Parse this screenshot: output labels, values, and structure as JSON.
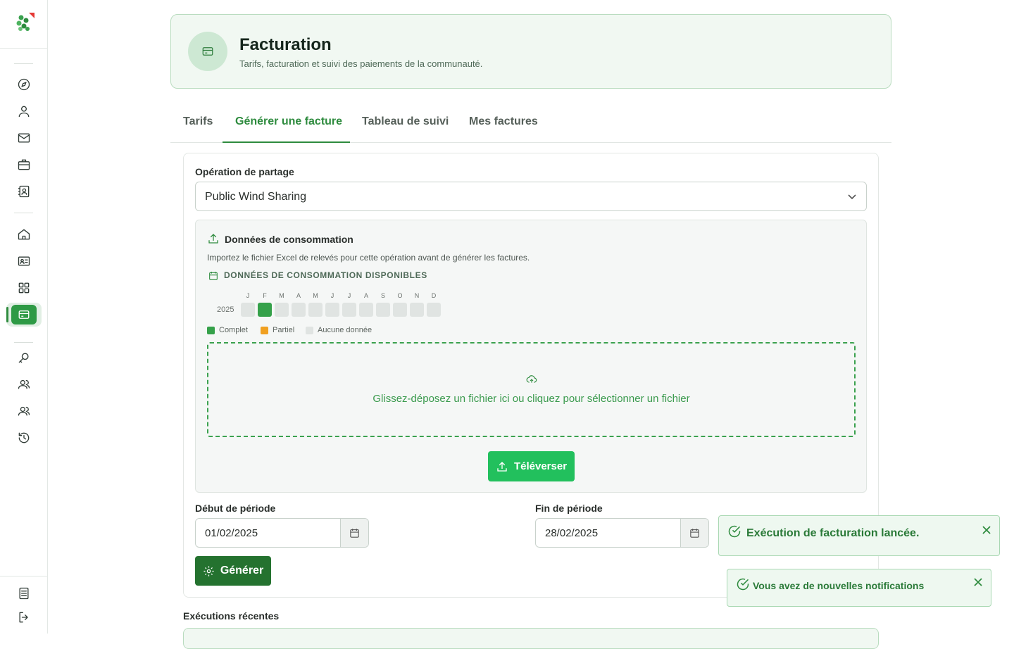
{
  "header": {
    "title": "Facturation",
    "subtitle": "Tarifs, facturation et suivi des paiements de la communauté."
  },
  "tabs": [
    {
      "label": "Tarifs",
      "active": false
    },
    {
      "label": "Générer une facture",
      "active": true
    },
    {
      "label": "Tableau de suivi",
      "active": false
    },
    {
      "label": "Mes factures",
      "active": false
    }
  ],
  "form": {
    "operation_label": "Opération de partage",
    "operation_value": "Public Wind Sharing",
    "consumption": {
      "title": "Données de consommation",
      "description": "Importez le fichier Excel de relevés pour cette opération avant de générer les factures.",
      "available_title": "DONNÉES DE CONSOMMATION DISPONIBLES",
      "year": "2025",
      "months": [
        {
          "letter": "J",
          "status": "none"
        },
        {
          "letter": "F",
          "status": "complete"
        },
        {
          "letter": "M",
          "status": "none"
        },
        {
          "letter": "A",
          "status": "none"
        },
        {
          "letter": "M",
          "status": "none"
        },
        {
          "letter": "J",
          "status": "none"
        },
        {
          "letter": "J",
          "status": "none"
        },
        {
          "letter": "A",
          "status": "none"
        },
        {
          "letter": "S",
          "status": "none"
        },
        {
          "letter": "O",
          "status": "none"
        },
        {
          "letter": "N",
          "status": "none"
        },
        {
          "letter": "D",
          "status": "none"
        }
      ],
      "legend": [
        {
          "label": "Complet",
          "color": "#35a14a"
        },
        {
          "label": "Partiel",
          "color": "#f0a020"
        },
        {
          "label": "Aucune donnée",
          "color": "#e0e4e2"
        }
      ],
      "dropzone_text": "Glissez-déposez un fichier ici ou cliquez pour sélectionner un fichier",
      "upload_label": "Téléverser"
    },
    "period_start_label": "Début de période",
    "period_start_value": "01/02/2025",
    "period_end_label": "Fin de période",
    "period_end_value": "28/02/2025",
    "generate_label": "Générer"
  },
  "recent": {
    "title": "Exécutions récentes"
  },
  "toasts": [
    {
      "text": "Exécution de facturation lancée."
    },
    {
      "text": "Vous avez de nouvelles notifications"
    }
  ],
  "colors": {
    "accent": "#2e8b3e",
    "upload": "#22c05d",
    "generate": "#24722f",
    "complete": "#35a14a",
    "partial": "#f0a020",
    "none": "#e0e4e2"
  }
}
